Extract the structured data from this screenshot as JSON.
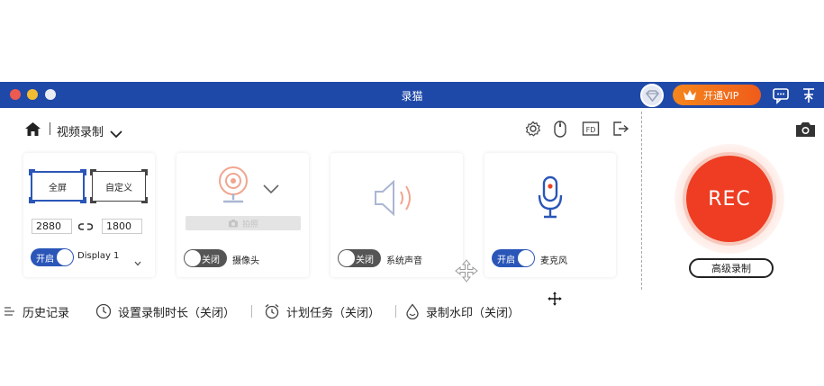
{
  "window": {
    "title": "录猫"
  },
  "titlebar": {
    "vip_label": "开通VIP"
  },
  "header": {
    "mode_label": "视频录制"
  },
  "cards": {
    "screen": {
      "full_label": "全屏",
      "custom_label": "自定义",
      "width": "2880",
      "height": "1800",
      "toggle_label": "开启",
      "display_label": "Display 1"
    },
    "camera": {
      "bar_label": "拍照",
      "toggle_label": "关闭",
      "label": "摄像头"
    },
    "audio": {
      "toggle_label": "关闭",
      "label": "系统声音"
    },
    "mic": {
      "toggle_label": "开启",
      "label": "麦克风"
    }
  },
  "record": {
    "rec_label": "REC",
    "advanced_label": "高级录制"
  },
  "bottom": {
    "history": "历史记录",
    "duration": "设置录制时长（关闭）",
    "schedule": "计划任务（关闭）",
    "watermark": "录制水印（关闭）"
  },
  "colors": {
    "titlebar": "#1f49a8",
    "accent": "#2a56b8",
    "rec": "#ee3d22",
    "vip": "#f5861d"
  }
}
